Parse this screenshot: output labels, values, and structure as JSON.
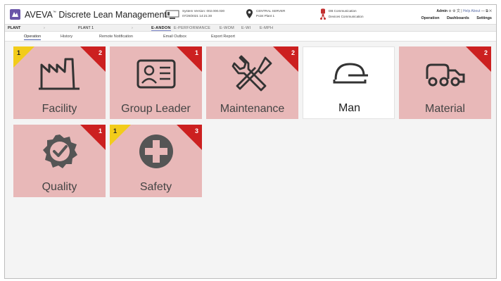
{
  "app": {
    "brand": "AVEVA",
    "tm": "™",
    "product": " Discrete Lean Management",
    "system_version": "System Version: 002.000.030",
    "system_date": "07/29/2021 14:21:30",
    "server_name": "CENTRAL SERVER",
    "server_plant": "Point Plant 1",
    "db_comm": "DB Communication",
    "device_comm": "Devices Communication",
    "user": "Admin",
    "help": "Help",
    "about": "About",
    "window_controls": "— ⧉ ✕"
  },
  "topnav": [
    "Operation",
    "Dashboards",
    "Settings"
  ],
  "plantbar": {
    "plant_label": "PLANT",
    "plant_value": "PLANT 1",
    "separator": "›",
    "modules": [
      "E-ANDON",
      "E-PERFORMANCE",
      "E-WOM",
      "E-WI",
      "E-MPH"
    ],
    "active_module": "E-ANDON"
  },
  "tabs": [
    "Operation",
    "History",
    "Remote Notification",
    "Email Outbox",
    "Export Report"
  ],
  "active_tab": "Operation",
  "tiles": [
    {
      "label": "Facility",
      "icon": "factory-icon",
      "red": "2",
      "yellow": "1"
    },
    {
      "label": "Group Leader",
      "icon": "id-card-icon",
      "red": "1",
      "yellow": ""
    },
    {
      "label": "Maintenance",
      "icon": "tools-icon",
      "red": "2",
      "yellow": ""
    },
    {
      "label": "Man",
      "icon": "hard-hat-icon",
      "red": "",
      "yellow": ""
    },
    {
      "label": "Material",
      "icon": "truck-icon",
      "red": "2",
      "yellow": ""
    },
    {
      "label": "Quality",
      "icon": "quality-badge-icon",
      "red": "1",
      "yellow": ""
    },
    {
      "label": "Safety",
      "icon": "medical-cross-icon",
      "red": "3",
      "yellow": "1"
    }
  ],
  "colors": {
    "alert_tile": "#e8b8b8",
    "normal_tile": "#ffffff",
    "red_badge": "#cc2020",
    "yellow_badge": "#f2cc1a",
    "accent": "#4a5ba8"
  }
}
